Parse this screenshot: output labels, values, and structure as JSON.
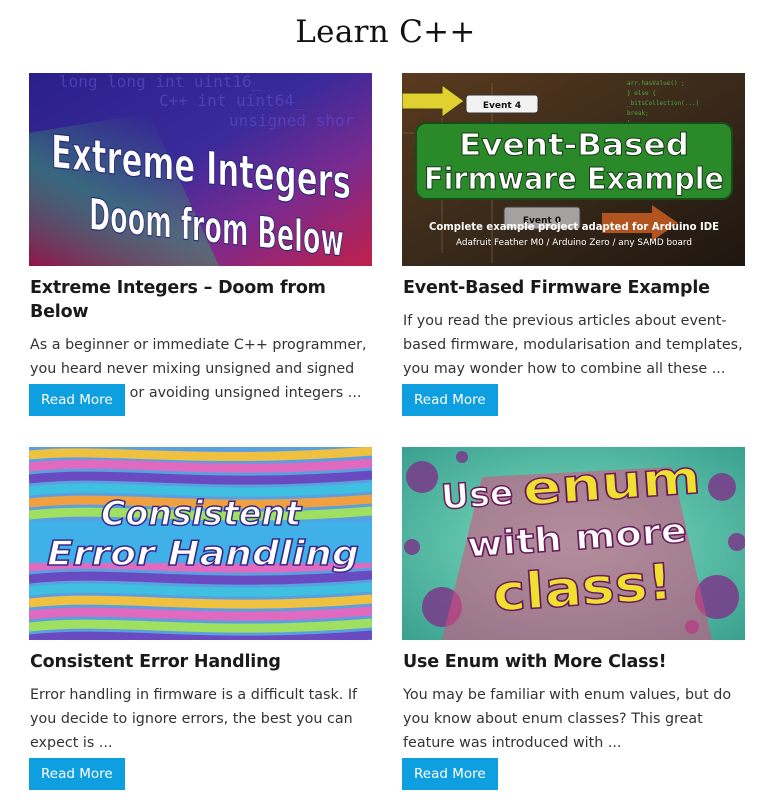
{
  "page": {
    "title": "Learn C++"
  },
  "cards": [
    {
      "image": {
        "lines": [
          "Extreme Integers",
          "Doom from Below"
        ],
        "code_lines": [
          "long long int  uint16_",
          "C++ int uint64_",
          "unsigned shor"
        ]
      },
      "title": "Extreme Integers – Doom from Below",
      "excerpt": "As a beginner or immediate C++ programmer, you heard never mixing unsigned and signed integer types or avoiding unsigned integers ...",
      "button": "Read More"
    },
    {
      "image": {
        "lines": [
          "Event-Based",
          "Firmware Example"
        ],
        "tags": [
          "Event 4",
          "Event 0"
        ],
        "subtitle": "Complete example project adapted for Arduino IDE",
        "subtitle2": "Adafruit Feather M0 / Arduino Zero / any SAMD board"
      },
      "title": "Event-Based Firmware Example",
      "excerpt": "If you read the previous articles about event-based firmware, modularisation and templates, you may wonder how to combine all these ...",
      "button": "Read More"
    },
    {
      "image": {
        "lines": [
          "Consistent",
          "Error Handling"
        ]
      },
      "title": "Consistent Error Handling",
      "excerpt": "Error handling in firmware is a difficult task. If you decide to ignore errors, the best you can expect is ...",
      "button": "Read More"
    },
    {
      "image": {
        "lines": [
          "Use",
          "enum",
          "with more",
          "class!"
        ]
      },
      "title": "Use Enum with More Class!",
      "excerpt": "You may be familiar with enum values, but do you know about enum classes? This great feature was introduced with ...",
      "button": "Read More"
    }
  ],
  "colors": {
    "accent": "#0e9fe0"
  }
}
